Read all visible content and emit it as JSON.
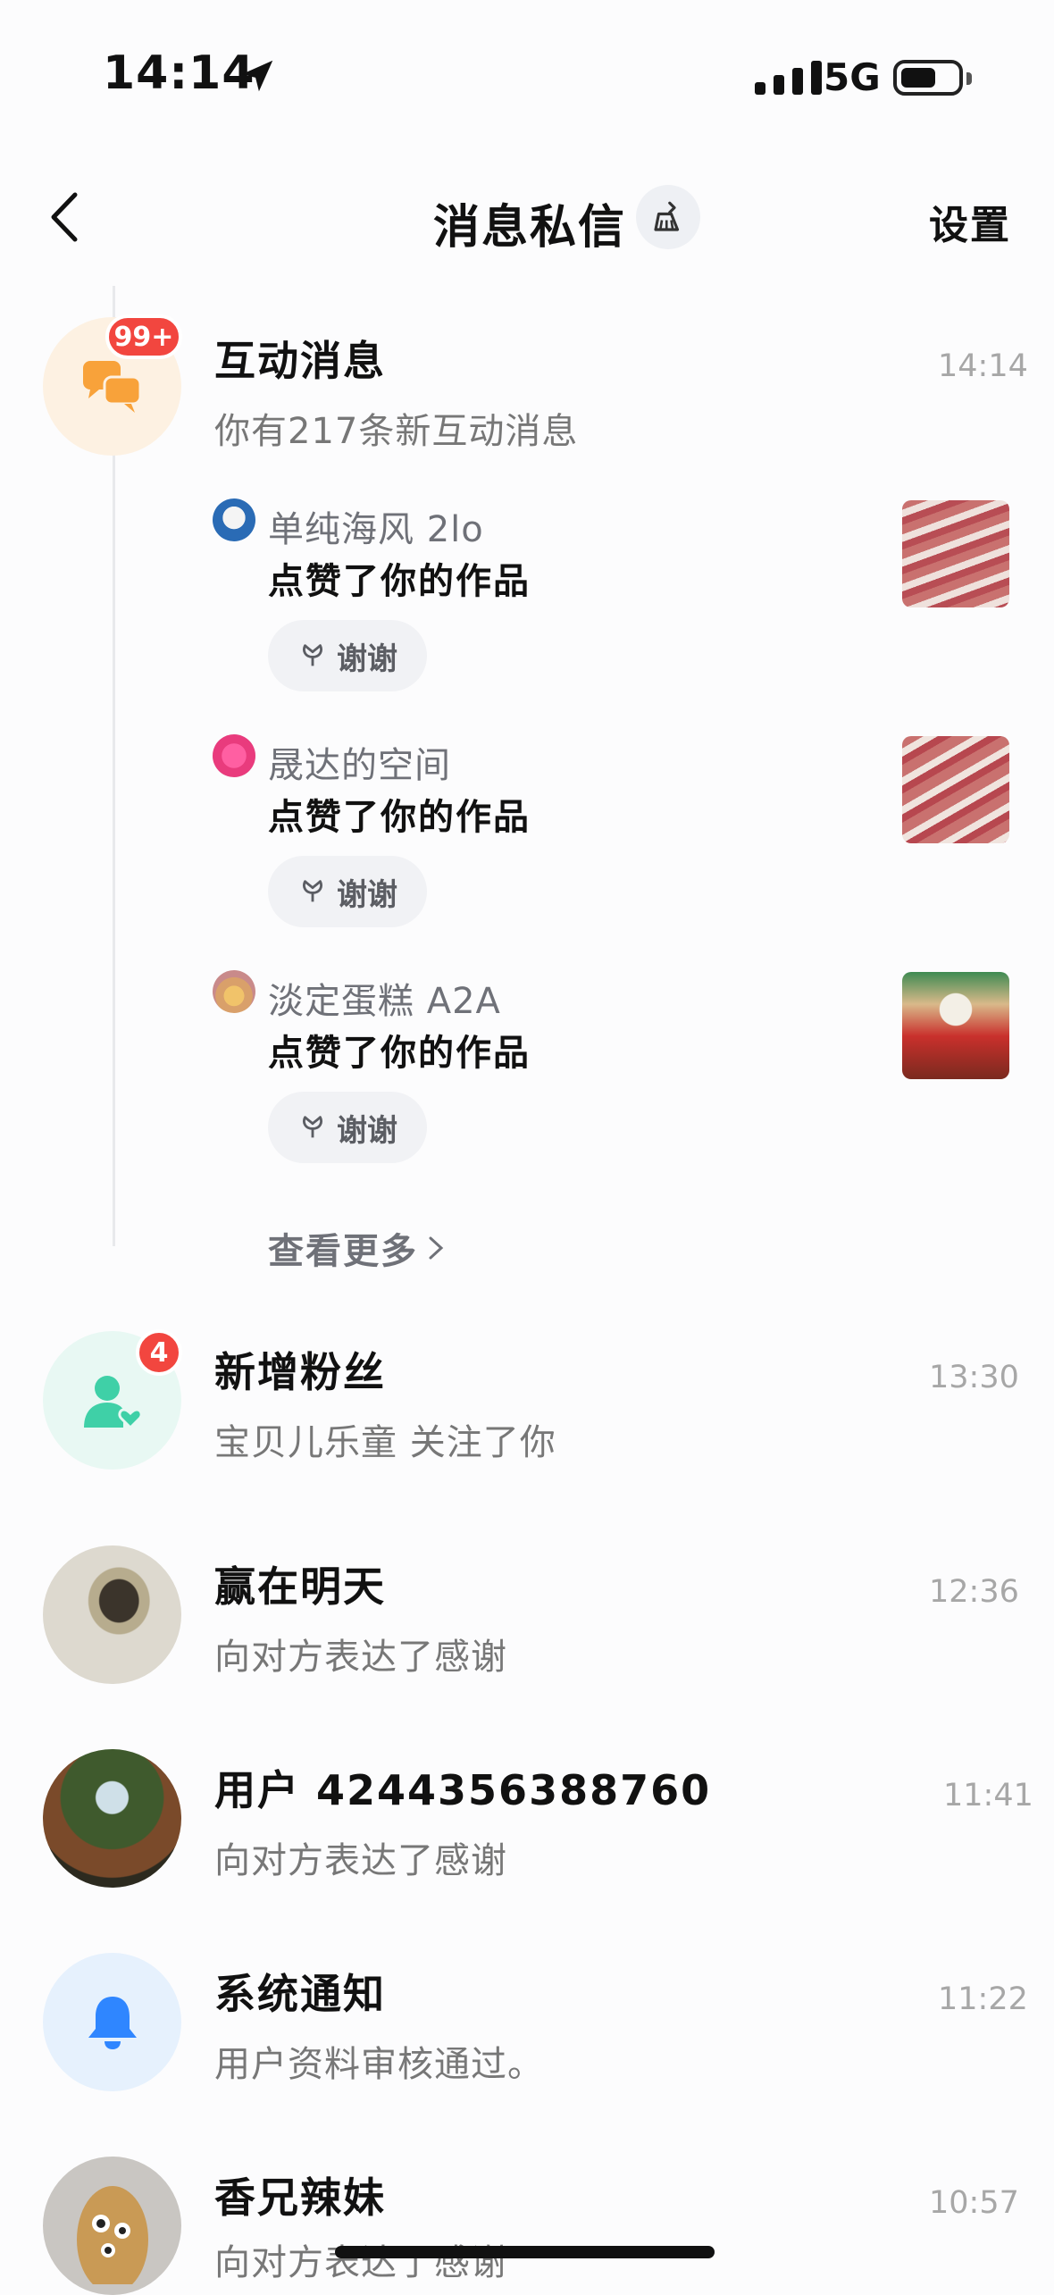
{
  "status_bar": {
    "time": "14:14",
    "network": "5G"
  },
  "header": {
    "title": "消息私信",
    "settings_label": "设置"
  },
  "interaction": {
    "title": "互动消息",
    "subtitle": "你有217条新互动消息",
    "time": "14:14",
    "badge": "99+",
    "items": [
      {
        "name": "单纯海风 2lo",
        "action": "点赞了你的作品",
        "thanks_label": "谢谢"
      },
      {
        "name": "晟达的空间",
        "action": "点赞了你的作品",
        "thanks_label": "谢谢"
      },
      {
        "name": "淡定蛋糕 A2A",
        "action": "点赞了你的作品",
        "thanks_label": "谢谢"
      }
    ],
    "view_more": "查看更多"
  },
  "conversations": [
    {
      "name": "新增粉丝",
      "preview": "宝贝儿乐童 关注了你",
      "time": "13:30",
      "badge": "4"
    },
    {
      "name": "赢在明天",
      "preview": "向对方表达了感谢",
      "time": "12:36"
    },
    {
      "name": "用户 4244356388760",
      "preview": "向对方表达了感谢",
      "time": "11:41"
    },
    {
      "name": "系统通知",
      "preview": "用户资料审核通过。",
      "time": "11:22"
    },
    {
      "name": "香兄辣妹",
      "preview": "向对方表达了感谢",
      "time": "10:57"
    }
  ],
  "colors": {
    "badge": "#f2463f",
    "interaction_icon": "#f8a23a",
    "fans_icon": "#3fd0a7",
    "system_icon": "#2f86ff"
  }
}
